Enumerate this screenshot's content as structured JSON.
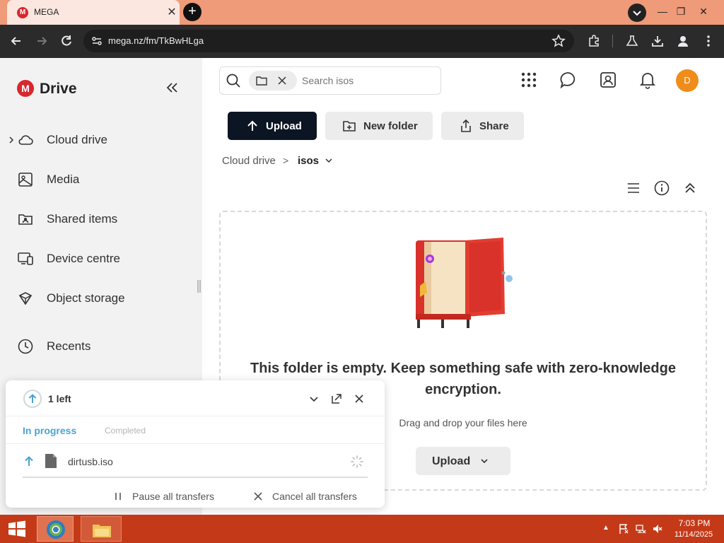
{
  "browser": {
    "tab_title": "MEGA",
    "tab_favicon": "M",
    "url": "mega.nz/fm/TkBwHLga",
    "accent": "#ef9a78"
  },
  "sidebar": {
    "brand_mark": "M",
    "title": "Drive",
    "items": [
      {
        "label": "Cloud drive",
        "icon": "cloud-icon"
      },
      {
        "label": "Media",
        "icon": "image-icon"
      },
      {
        "label": "Shared items",
        "icon": "shared-folder-icon"
      },
      {
        "label": "Device centre",
        "icon": "devices-icon"
      },
      {
        "label": "Object storage",
        "icon": "object-storage-icon"
      },
      {
        "label": "Recents",
        "icon": "clock-icon"
      }
    ]
  },
  "search": {
    "placeholder": "Search isos"
  },
  "header": {
    "avatar_initial": "D"
  },
  "actions": {
    "upload": "Upload",
    "new_folder": "New folder",
    "share": "Share"
  },
  "breadcrumb": {
    "root": "Cloud drive",
    "separator": ">",
    "current": "isos"
  },
  "empty_state": {
    "title": "This folder is empty. Keep something safe with zero-knowledge encryption.",
    "subtitle": "Drag and drop your files here",
    "upload_label": "Upload"
  },
  "transfers": {
    "count_label": "1 left",
    "tab_in_progress": "In progress",
    "tab_completed": "Completed",
    "items": [
      {
        "name": "dirtusb.iso"
      }
    ],
    "pause_all": "Pause all transfers",
    "cancel_all": "Cancel all transfers"
  },
  "taskbar": {
    "time": "7:03 PM",
    "date": "11/14/2025"
  },
  "colors": {
    "brand_red": "#d9272e",
    "upload_dark": "#0c1523",
    "transfer_blue": "#4aa3d2",
    "avatar": "#f08c1a",
    "taskbar": "#c43a18"
  }
}
